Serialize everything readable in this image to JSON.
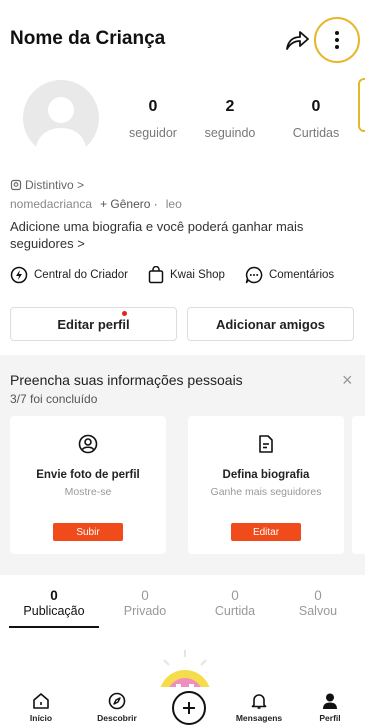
{
  "header": {
    "title": "Nome da Criança"
  },
  "profile": {
    "stats": [
      {
        "value": "0",
        "label": "seguidor"
      },
      {
        "value": "2",
        "label": "seguindo"
      },
      {
        "value": "0",
        "label": "Curtidas"
      }
    ],
    "badge_label": "Distintivo >",
    "username": "nomedacrianca",
    "gender_label": "+ Gênero ·",
    "extra": "leo",
    "bio": "Adicione uma biografia e você poderá ganhar mais seguidores >"
  },
  "links": [
    {
      "label": "Central do Criador",
      "icon": "lightning-icon"
    },
    {
      "label": "Kwai Shop",
      "icon": "shopping-bag-icon"
    },
    {
      "label": "Comentários",
      "icon": "chat-bubble-icon"
    }
  ],
  "actions": {
    "edit_profile": "Editar perfil",
    "add_friends": "Adicionar amigos"
  },
  "completion_card": {
    "title": "Preencha suas informações pessoais",
    "progress": "3/7 foi concluído",
    "progress_fraction": 0.4286,
    "close": "×",
    "items": [
      {
        "title": "Envie foto de perfil",
        "subtitle": "Mostre-se",
        "button": "Subir"
      },
      {
        "title": "Defina biografia",
        "subtitle": "Ganhe mais seguidores",
        "button": "Editar"
      }
    ]
  },
  "tabs": [
    {
      "count": "0",
      "label": "Publicação",
      "active": true
    },
    {
      "count": "0",
      "label": "Privado"
    },
    {
      "count": "0",
      "label": "Curtida"
    },
    {
      "count": "0",
      "label": "Salvou"
    }
  ],
  "bottom_nav": [
    {
      "label": "Início",
      "icon": "home-icon"
    },
    {
      "label": "Descobrir",
      "icon": "compass-icon"
    },
    {
      "label": "",
      "icon": "plus-icon"
    },
    {
      "label": "Mensagens",
      "icon": "bell-icon"
    },
    {
      "label": "Perfil",
      "icon": "person-icon",
      "active": true
    }
  ],
  "colors": {
    "accent": "#f04b1a",
    "highlight": "#e8b62a",
    "notification_dot": "#e52222"
  }
}
